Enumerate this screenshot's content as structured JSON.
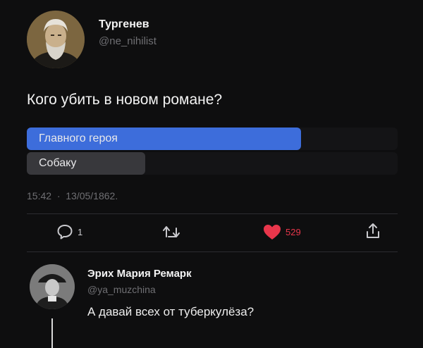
{
  "post": {
    "author_name": "Тургенев",
    "author_handle": "@ne_nihilist",
    "question": "Кого убить в новом романе?",
    "poll": {
      "options": [
        {
          "label": "Главного героя",
          "share": 0.74,
          "color": "#3d6ddb"
        },
        {
          "label": "Собаку",
          "share": 0.32,
          "color": "#38383c"
        }
      ]
    },
    "timestamp": "15:42  ·  13/05/1862.",
    "actions": {
      "reply_count": "1",
      "like_count": "529",
      "like_color": "#e8364b"
    }
  },
  "reply": {
    "author_name": "Эрих Мария Ремарк",
    "author_handle": "@ya_muzchina",
    "text": "А давай всех от туберкулёза?"
  },
  "icons": [
    "reply-icon",
    "retweet-icon",
    "heart-icon",
    "share-icon"
  ]
}
